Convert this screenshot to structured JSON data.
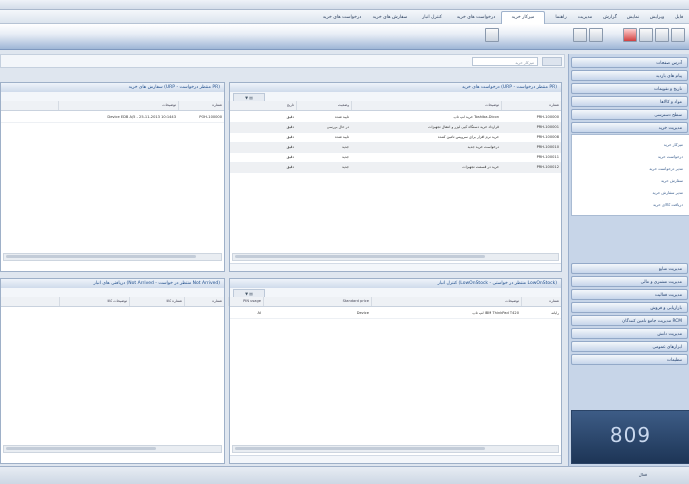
{
  "menu": {
    "tabs": [
      {
        "label": "فایل"
      },
      {
        "label": "ویرایش"
      },
      {
        "label": "نمایش"
      },
      {
        "label": "گزارش"
      },
      {
        "label": "مدیریت"
      },
      {
        "label": "راهنما"
      },
      {
        "label": "میزکار خرید"
      },
      {
        "label": "درخواست های خرید"
      },
      {
        "label": "کنترل انبار"
      },
      {
        "label": "سفارش های خرید"
      },
      {
        "label": "درخواست های خرید"
      }
    ]
  },
  "address": {
    "label": "میزکار خرید"
  },
  "panels": {
    "purchase_requests": {
      "title": "درخواست های خرید (URP - منتظر درخواست PR)",
      "columns": [
        "شماره",
        "توضیحات",
        "وضعیت",
        "تاریخ"
      ],
      "rows": [
        [
          "PRH-100000",
          "خرید لپ تاپ Toshiba-Dicon",
          "تایید شده",
          "دقیق"
        ],
        [
          "PRH-100001",
          "قرارداد خرید دستگاه کپی لیزر و انتقال تجهیزات",
          "در حال بررسی",
          "دقیق"
        ],
        [
          "PRH-100008",
          "خرید نرم افزار برای سرویس تامین کننده",
          "تایید شده",
          "دقیق"
        ],
        [
          "PRH-100010",
          "درخواست خرید جدید",
          "جدید",
          "دقیق"
        ],
        [
          "PRH-100011",
          "",
          "جدید",
          "دقیق"
        ],
        [
          "PRH-100012",
          "خرید در قسمت تجهیزات",
          "جدید",
          "دقیق"
        ]
      ]
    },
    "purchase_orders": {
      "title": "سفارش های خرید (URP - منتظر درخواست PR)",
      "columns": [
        "شماره",
        "توضیحات"
      ],
      "rows": [
        [
          "POH-100000",
          "Device EDB A/5 - 25-11-2013 10:1443"
        ]
      ]
    },
    "inventory": {
      "title": "کنترل انبار (LowOnStock - منتظر در خواستی LowOnStock)",
      "columns": [
        "شماره",
        "توضیحات",
        "Standard price",
        "PIN usage"
      ],
      "rows": [
        [
          "رایانه",
          "لپ تاپ IBM ThinkPad T420",
          "Device",
          "AI"
        ]
      ]
    },
    "receipts": {
      "title": "دریافتی های انبار (Not Arrived - منتظر در خواست Not Arrived)",
      "columns": [
        "شماره",
        "شماره کالا",
        "توضیحات کالا"
      ]
    }
  },
  "sidebar": {
    "items": [
      {
        "label": "آدرس صفحات"
      },
      {
        "label": "پیام های بازدید"
      },
      {
        "label": "تاریخ و تقویمات"
      },
      {
        "label": "مواد و کالاها"
      },
      {
        "label": "سطح دسترسی"
      },
      {
        "label": "مدیریت خرید"
      }
    ],
    "sub_items": [
      {
        "label": "میزکار خرید"
      },
      {
        "label": "درخواست خرید"
      },
      {
        "label": "مدیر درخواست خرید"
      },
      {
        "label": "سفارش خرید"
      },
      {
        "label": "مدیر سفارش خرید"
      },
      {
        "label": "دریافت کالای خرید"
      }
    ],
    "items_bottom": [
      {
        "label": "مدیریت منابع"
      },
      {
        "label": "مدیریت مشتری و مالی"
      },
      {
        "label": "مدیریت فعالیت"
      },
      {
        "label": "بازاریابی و فروش"
      },
      {
        "label": "مدیریت جامع تامین کنندگان RCM"
      },
      {
        "label": "مدیریت دانش"
      },
      {
        "label": "ابزارهای عمومی"
      },
      {
        "label": "تنظیمات"
      }
    ],
    "logo_text": "809"
  },
  "status": {
    "label": "فعال"
  },
  "colors": {
    "accent": "#1f4e8c",
    "sidebar": "#c7d5e8",
    "logo": "#1d3556"
  }
}
